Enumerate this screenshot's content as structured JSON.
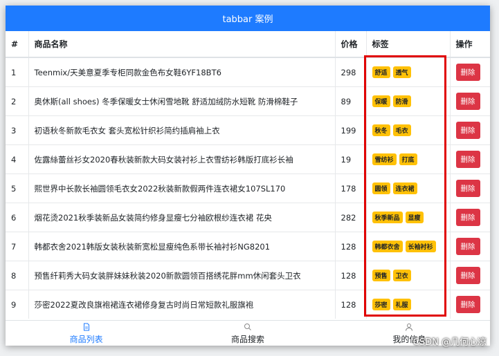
{
  "header": {
    "title": "tabbar 案例"
  },
  "table": {
    "columns": [
      "#",
      "商品名称",
      "价格",
      "标签",
      "操作"
    ],
    "delete_label": "删除",
    "rows": [
      {
        "index": "1",
        "name": "Teenmix/天美意夏季专柜同款金色布女鞋6YF18BT6",
        "price": "298",
        "tags": [
          "舒适",
          "透气"
        ]
      },
      {
        "index": "2",
        "name": "奥休斯(all shoes) 冬季保暖女士休闲雪地靴 舒适加绒防水短靴 防滑棉鞋子",
        "price": "89",
        "tags": [
          "保暖",
          "防滑"
        ]
      },
      {
        "index": "3",
        "name": "初语秋冬新款毛衣女 套头宽松针织衫简约插肩袖上衣",
        "price": "199",
        "tags": [
          "秋冬",
          "毛衣"
        ]
      },
      {
        "index": "4",
        "name": "佐露絲蕾丝衫女2020春秋装新款大码女装衬衫上衣雪纺衫韩版打底衫长袖",
        "price": "19",
        "tags": [
          "雪纺衫",
          "打底"
        ]
      },
      {
        "index": "5",
        "name": "熙世界中长款长袖圆领毛衣女2022秋装新款假两件连衣裙女107SL170",
        "price": "178",
        "tags": [
          "圆领",
          "连衣裙"
        ]
      },
      {
        "index": "6",
        "name": "烟花烫2021秋季装新品女装简约修身显瘦七分袖欧根纱连衣裙 花央",
        "price": "282",
        "tags": [
          "秋季新品",
          "显瘦"
        ]
      },
      {
        "index": "7",
        "name": "韩都衣舍2021韩版女装秋装新宽松显瘦纯色系带长袖衬衫NG8201",
        "price": "128",
        "tags": [
          "韩都衣舍",
          "长袖衬衫"
        ]
      },
      {
        "index": "8",
        "name": "预售纤莉秀大码女装胖妹妹秋装2020新款圆领百搭绣花胖mm休闲套头卫衣",
        "price": "128",
        "tags": [
          "预售",
          "卫衣"
        ]
      },
      {
        "index": "9",
        "name": "莎密2022夏改良旗袍裙连衣裙修身复古时尚日常短款礼服旗袍",
        "price": "128",
        "tags": [
          "莎密",
          "礼服"
        ]
      }
    ]
  },
  "tabbar": {
    "items": [
      {
        "label": "商品列表",
        "icon": "document-icon",
        "active": true
      },
      {
        "label": "商品搜索",
        "icon": "search-icon",
        "active": false
      },
      {
        "label": "我的信息",
        "icon": "user-icon",
        "active": false
      }
    ]
  },
  "watermark": "CSDN @几何心凉",
  "colors": {
    "primary": "#1e7bff",
    "danger": "#dc3545",
    "tag": "#ffc107",
    "highlight": "#e00000"
  }
}
